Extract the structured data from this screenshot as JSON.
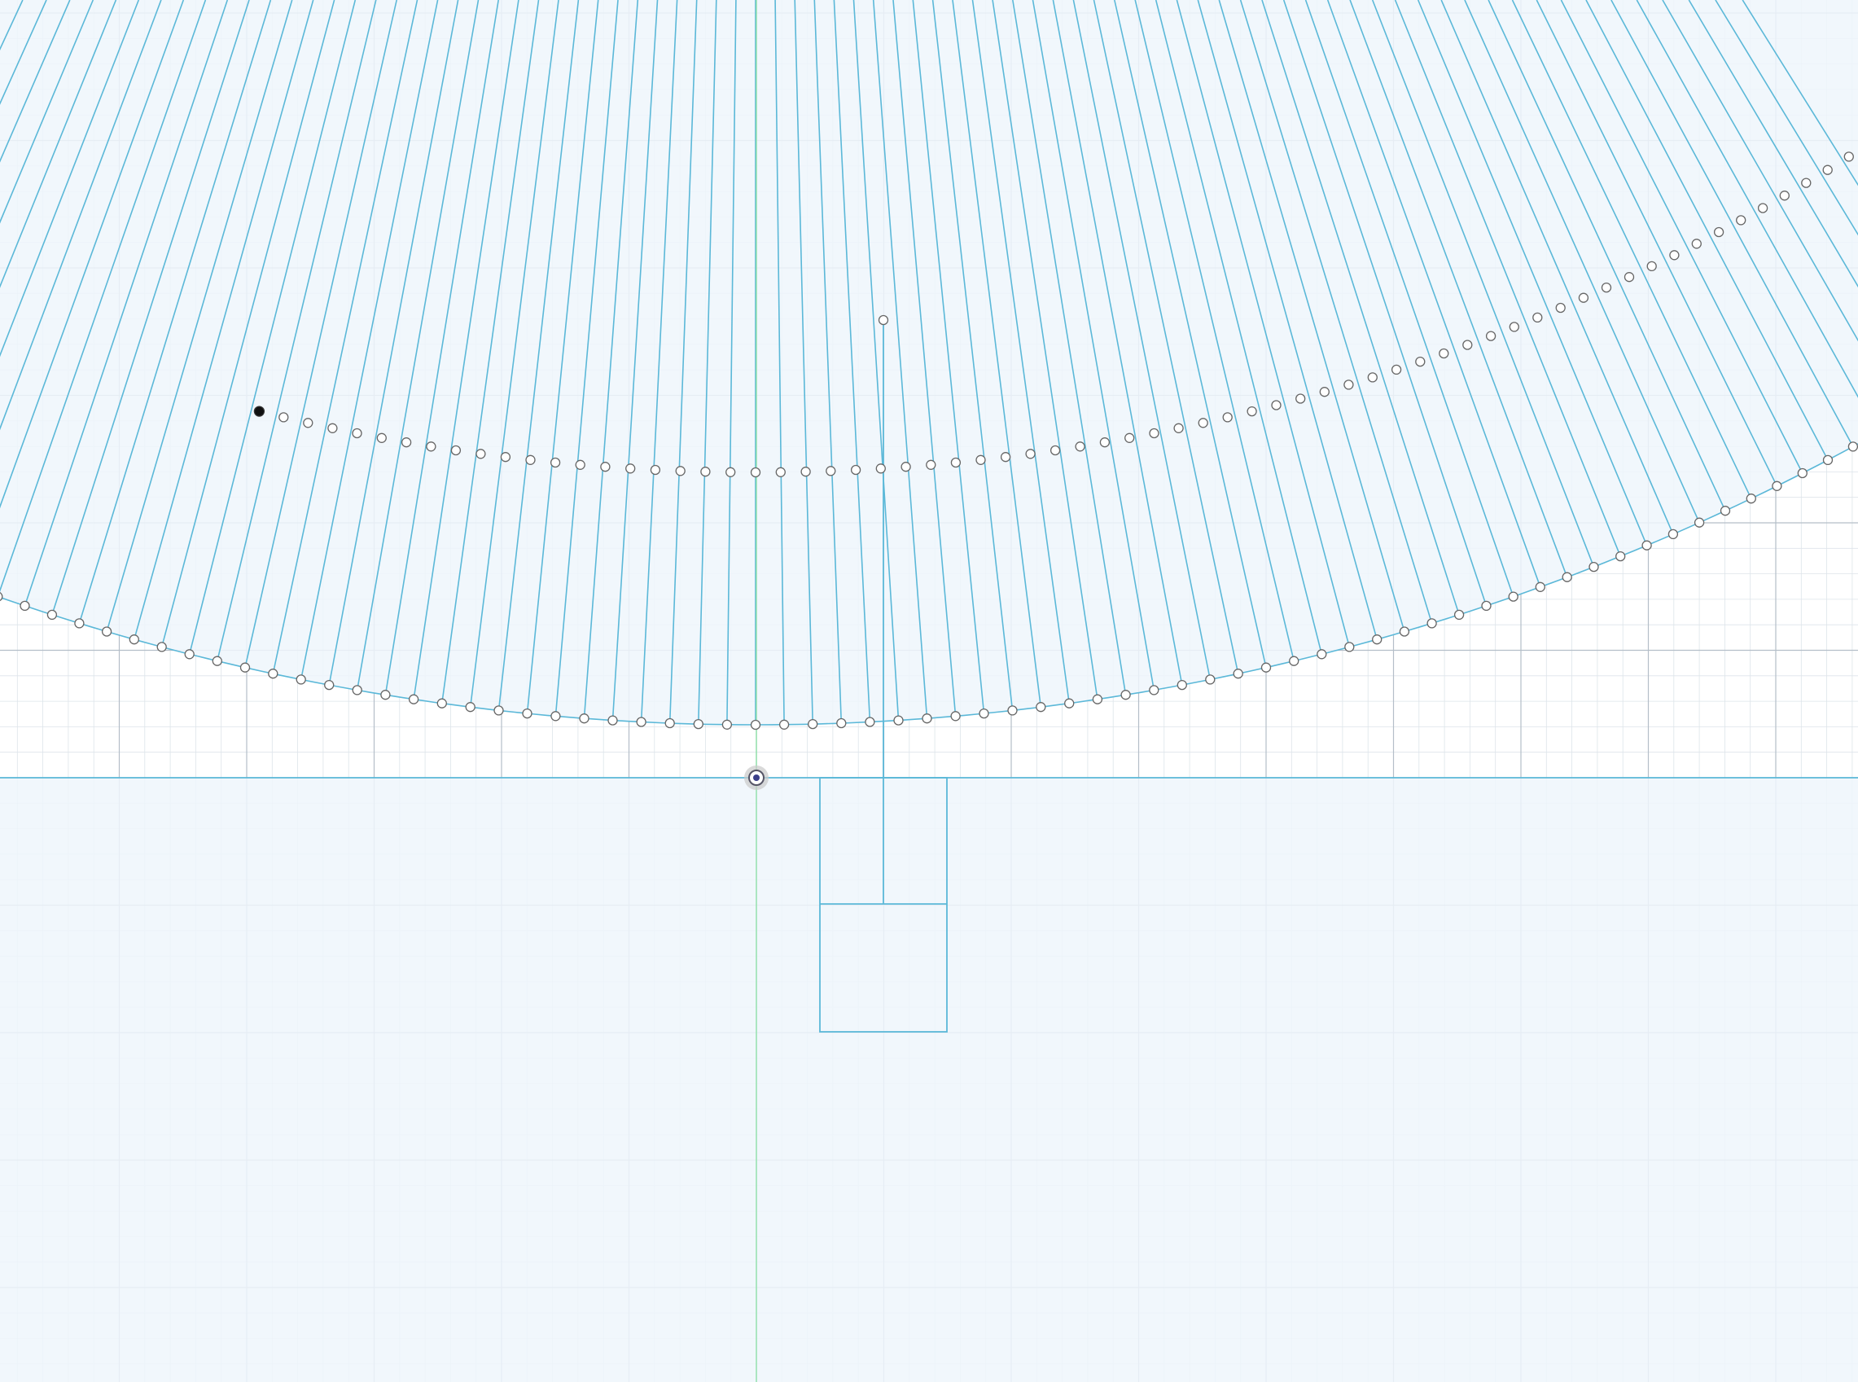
{
  "canvas": {
    "background": "#ffffff",
    "grid_minor_color": "#dde4ea",
    "grid_major_color": "#b4bec8",
    "region_fill": "#eef6fb",
    "line_color": "#5bb8d8",
    "origin_axis_color": "#8ee0a8",
    "handle_fill": "#ffffff",
    "handle_stroke": "#666666",
    "selected_handle_fill": "#111111"
  },
  "sketch": {
    "radial_lines": "construction-lines",
    "outer_arc": "arc-handles",
    "inner_arc": "arc-handles",
    "selected_point_icon": "selected-point-icon",
    "origin_icon": "origin-target-icon",
    "profile_rectangle": "rectangle-profile"
  }
}
